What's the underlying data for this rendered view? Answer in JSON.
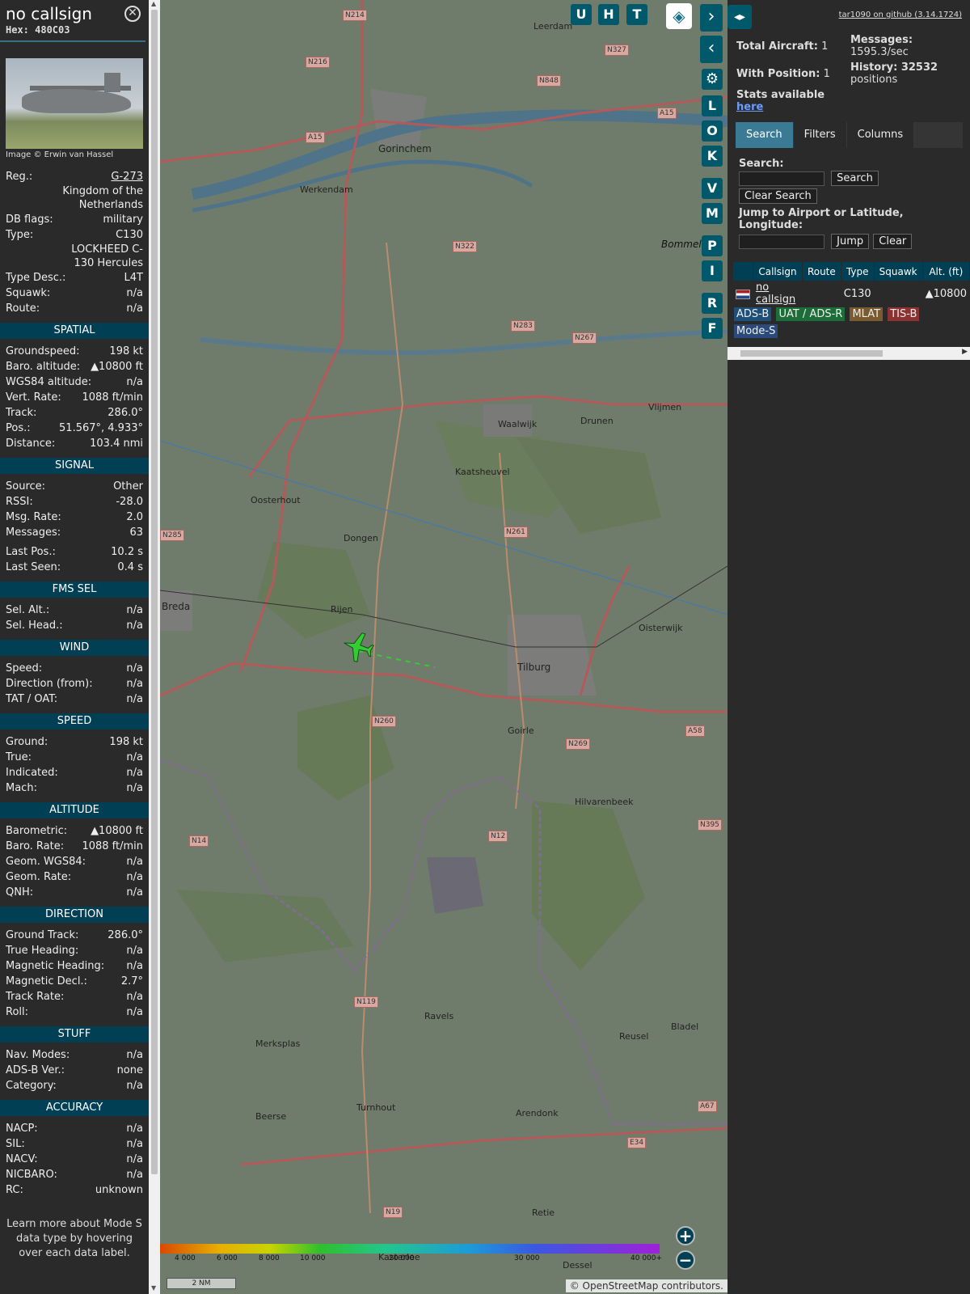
{
  "detail": {
    "callsign": "no callsign",
    "hex_label": "Hex: 480C03",
    "photo_credit": "Image © Erwin van Hassel",
    "info": [
      {
        "k": "Reg.:",
        "v": "G-273",
        "link": true
      },
      {
        "k": "",
        "v": "Kingdom of the Netherlands"
      },
      {
        "k": "DB flags:",
        "v": "military"
      },
      {
        "k": "Type:",
        "v": "C130"
      },
      {
        "k": "",
        "v": "LOCKHEED C-130 Hercules"
      },
      {
        "k": "Type Desc.:",
        "v": "L4T"
      },
      {
        "k": "Squawk:",
        "v": "n/a"
      },
      {
        "k": "Route:",
        "v": "n/a"
      }
    ],
    "sections": [
      {
        "title": "SPATIAL",
        "rows": [
          {
            "k": "Groundspeed:",
            "v": "198 kt"
          },
          {
            "k": "Baro. altitude:",
            "v": "▲10800 ft"
          },
          {
            "k": "WGS84 altitude:",
            "v": "n/a"
          },
          {
            "k": "Vert. Rate:",
            "v": "1088 ft/min"
          },
          {
            "k": "Track:",
            "v": "286.0°"
          },
          {
            "k": "Pos.:",
            "v": "51.567°, 4.933°"
          },
          {
            "k": "Distance:",
            "v": "103.4 nmi"
          }
        ]
      },
      {
        "title": "SIGNAL",
        "rows": [
          {
            "k": "Source:",
            "v": "Other"
          },
          {
            "k": "RSSI:",
            "v": "-28.0"
          },
          {
            "k": "Msg. Rate:",
            "v": "2.0"
          },
          {
            "k": "Messages:",
            "v": "63"
          },
          {
            "k": "",
            "v": "",
            "gap": true
          },
          {
            "k": "Last Pos.:",
            "v": "10.2 s"
          },
          {
            "k": "Last Seen:",
            "v": "0.4 s"
          }
        ]
      },
      {
        "title": "FMS SEL",
        "rows": [
          {
            "k": "Sel. Alt.:",
            "v": "n/a"
          },
          {
            "k": "Sel. Head.:",
            "v": "n/a"
          }
        ]
      },
      {
        "title": "WIND",
        "rows": [
          {
            "k": "Speed:",
            "v": "n/a"
          },
          {
            "k": "Direction (from):",
            "v": "n/a"
          },
          {
            "k": "TAT / OAT:",
            "v": "n/a"
          }
        ]
      },
      {
        "title": "SPEED",
        "rows": [
          {
            "k": "Ground:",
            "v": "198 kt"
          },
          {
            "k": "True:",
            "v": "n/a"
          },
          {
            "k": "Indicated:",
            "v": "n/a"
          },
          {
            "k": "Mach:",
            "v": "n/a"
          }
        ]
      },
      {
        "title": "ALTITUDE",
        "rows": [
          {
            "k": "Barometric:",
            "v": "▲10800 ft"
          },
          {
            "k": "Baro. Rate:",
            "v": "1088 ft/min"
          },
          {
            "k": "Geom. WGS84:",
            "v": "n/a"
          },
          {
            "k": "Geom. Rate:",
            "v": "n/a"
          },
          {
            "k": "QNH:",
            "v": "n/a"
          }
        ]
      },
      {
        "title": "DIRECTION",
        "rows": [
          {
            "k": "Ground Track:",
            "v": "286.0°"
          },
          {
            "k": "True Heading:",
            "v": "n/a"
          },
          {
            "k": "Magnetic Heading:",
            "v": "n/a"
          },
          {
            "k": "Magnetic Decl.:",
            "v": "2.7°"
          },
          {
            "k": "Track Rate:",
            "v": "n/a"
          },
          {
            "k": "Roll:",
            "v": "n/a"
          }
        ]
      },
      {
        "title": "STUFF",
        "rows": [
          {
            "k": "Nav. Modes:",
            "v": "n/a"
          },
          {
            "k": "ADS-B Ver.:",
            "v": "none"
          },
          {
            "k": "Category:",
            "v": "n/a"
          }
        ]
      },
      {
        "title": "ACCURACY",
        "rows": [
          {
            "k": "NACP:",
            "v": "n/a"
          },
          {
            "k": "SIL:",
            "v": "n/a"
          },
          {
            "k": "NACV:",
            "v": "n/a"
          },
          {
            "k": "NICBARO:",
            "v": "n/a"
          },
          {
            "k": "RC:",
            "v": "unknown"
          }
        ]
      }
    ],
    "footnote": "Learn more about Mode S data type by hovering over each data label."
  },
  "map": {
    "buttons_top": [
      "U",
      "H",
      "T"
    ],
    "buttons_side": [
      "L",
      "O",
      "K",
      "V",
      "M",
      "P",
      "I",
      "R",
      "F"
    ],
    "places": [
      {
        "name": "Leerdam"
      },
      {
        "name": "Gorinchem"
      },
      {
        "name": "Werkendam"
      },
      {
        "name": "Waalwijk"
      },
      {
        "name": "Drunen"
      },
      {
        "name": "Vlijmen"
      },
      {
        "name": "Kaatsheuvel"
      },
      {
        "name": "Oosterhout"
      },
      {
        "name": "Dongen"
      },
      {
        "name": "Breda"
      },
      {
        "name": "Rijen"
      },
      {
        "name": "Tilburg"
      },
      {
        "name": "Oisterwijk"
      },
      {
        "name": "Goirle"
      },
      {
        "name": "Hilvarenbeek"
      },
      {
        "name": "Ravels"
      },
      {
        "name": "Merksplas"
      },
      {
        "name": "Reusel"
      },
      {
        "name": "Bladel"
      },
      {
        "name": "Beerse"
      },
      {
        "name": "Turnhout"
      },
      {
        "name": "Arendonk"
      },
      {
        "name": "Retie"
      },
      {
        "name": "Dessel"
      },
      {
        "name": "Bommel"
      },
      {
        "name": "Kasterlee"
      }
    ],
    "roads": [
      "N214",
      "N327",
      "N216",
      "N848",
      "A15",
      "A15",
      "N322",
      "N283",
      "N267",
      "N261",
      "N285",
      "N260",
      "N269",
      "A58",
      "N395",
      "N14",
      "N12",
      "N119",
      "A67",
      "E34",
      "N19"
    ],
    "altitude_scale": [
      "4 000",
      "6 000",
      "8 000",
      "10 000",
      "20 000",
      "30 000",
      "40 000+"
    ],
    "scale_label": "2 NM",
    "attribution": "© OpenStreetMap contributors."
  },
  "sidebar": {
    "github_link": "tar1090 on github (3.14.1724)",
    "total_aircraft_label": "Total Aircraft:",
    "total_aircraft": "1",
    "with_position_label": "With Position:",
    "with_position": "1",
    "messages_label": "Messages:",
    "messages_rate": "1595.3/sec",
    "history_label": "History: 32532",
    "history_unit": "positions",
    "stats_label": "Stats available",
    "stats_link": "here",
    "tabs": [
      "Search",
      "Filters",
      "Columns"
    ],
    "search_label": "Search:",
    "search_button": "Search",
    "clear_search_button": "Clear Search",
    "jump_label": "Jump to Airport or Latitude, Longitude:",
    "jump_button": "Jump",
    "clear_button": "Clear",
    "columns": [
      "Callsign",
      "Route",
      "Type",
      "Squawk",
      "Alt. (ft)"
    ],
    "rows": [
      {
        "callsign": "no callsign",
        "route": "",
        "type": "C130",
        "squawk": "",
        "alt": "▲10800"
      }
    ],
    "sources": [
      "ADS-B",
      "UAT / ADS-R",
      "MLAT",
      "TIS-B",
      "Mode-S"
    ]
  },
  "colors": {
    "accent": "#003f54",
    "button": "#00596b",
    "active_tab": "#3a7a94",
    "aircraft": "#33cc33"
  }
}
